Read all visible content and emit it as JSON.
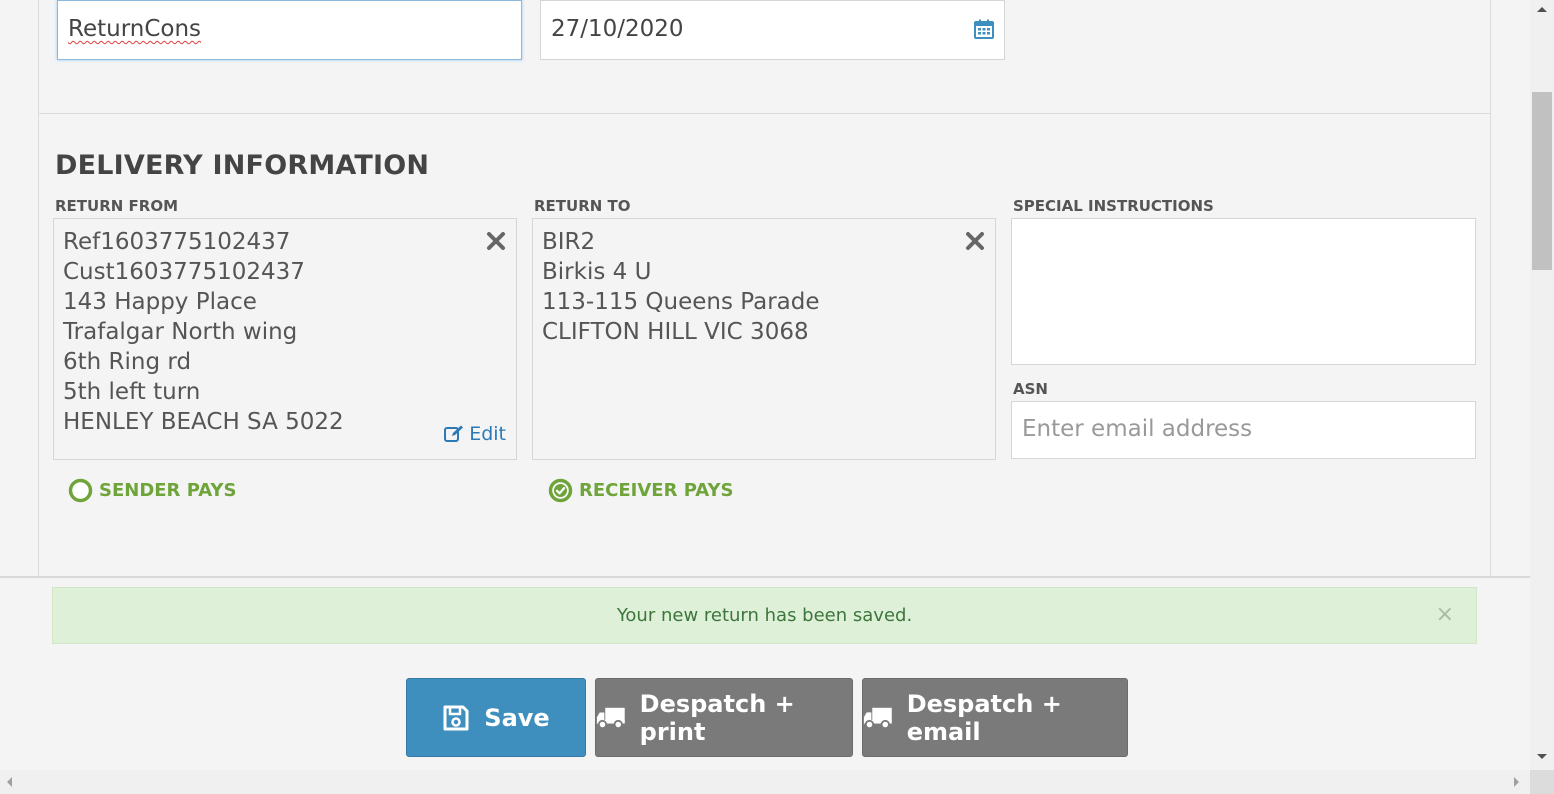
{
  "header": {
    "reference_value": "ReturnCons",
    "date_value": "27/10/2020",
    "calendar_icon": "calendar-icon"
  },
  "delivery": {
    "title": "DELIVERY INFORMATION",
    "return_from": {
      "label": "RETURN FROM",
      "lines": [
        "Ref1603775102437",
        "Cust1603775102437",
        "143 Happy Place",
        "Trafalgar North wing",
        "6th Ring rd",
        "5th left turn",
        "HENLEY BEACH SA 5022"
      ],
      "edit_label": "Edit"
    },
    "return_to": {
      "label": "RETURN TO",
      "lines": [
        "BIR2",
        "Birkis 4 U",
        "113-115 Queens Parade",
        "CLIFTON HILL VIC 3068"
      ]
    },
    "special_instructions": {
      "label": "SPECIAL INSTRUCTIONS",
      "value": ""
    },
    "asn": {
      "label": "ASN",
      "placeholder": "Enter email address"
    },
    "sender_pays": {
      "label": "SENDER PAYS",
      "selected": false
    },
    "receiver_pays": {
      "label": "RECEIVER PAYS",
      "selected": true
    }
  },
  "alert": {
    "message": "Your new return has been saved.",
    "close_label": "×"
  },
  "actions": {
    "save_label": "Save",
    "print_label": "Despatch + print",
    "email_label": "Despatch + email"
  },
  "colors": {
    "primary": "#3f8fbe",
    "secondary": "#7a7a7a",
    "success_bg": "#dff0d8",
    "success_text": "#3c763d",
    "pays_green": "#6ea43a",
    "link": "#2a7ab8"
  }
}
